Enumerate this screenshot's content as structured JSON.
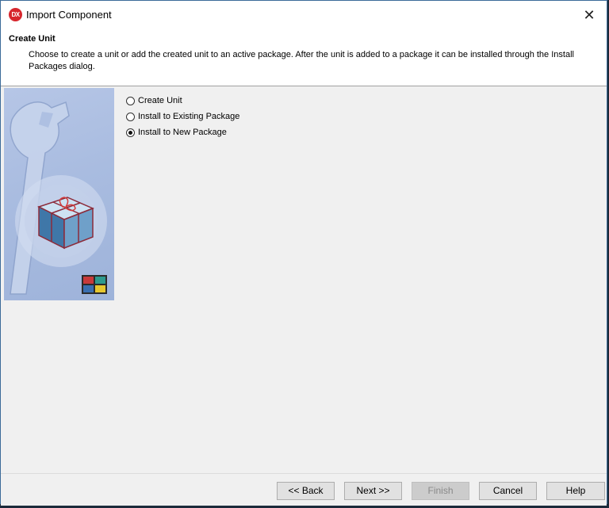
{
  "window": {
    "title": "Import Component",
    "app_badge": "DX",
    "close_glyph": "✕"
  },
  "header": {
    "title": "Create Unit",
    "description": "Choose to create a unit or add the created unit to an active package. After the unit is added to a package it can be installed through the Install Packages dialog."
  },
  "options": [
    {
      "label": "Create Unit",
      "checked": false
    },
    {
      "label": "Install to Existing Package",
      "checked": false
    },
    {
      "label": "Install to New Package",
      "checked": true
    }
  ],
  "buttons": {
    "back": "<< Back",
    "next": "Next >>",
    "finish": "Finish",
    "cancel": "Cancel",
    "help": "Help"
  },
  "colors": {
    "app_badge": "#d7262d",
    "side_panel": "#a9bce0"
  }
}
